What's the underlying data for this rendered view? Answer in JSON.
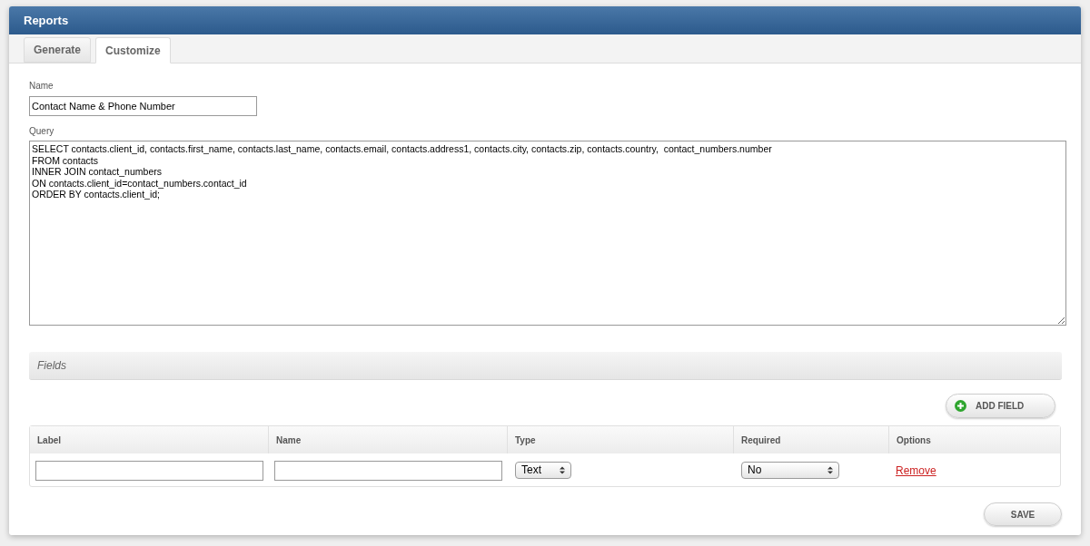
{
  "panel": {
    "title": "Reports"
  },
  "tabs": [
    {
      "label": "Generate",
      "selected": false
    },
    {
      "label": "Customize",
      "selected": true
    }
  ],
  "form": {
    "name_label": "Name",
    "name_value": "Contact Name & Phone Number",
    "query_label": "Query",
    "query_value": "SELECT contacts.client_id, contacts.first_name, contacts.last_name, contacts.email, contacts.address1, contacts.city, contacts.zip, contacts.country,  contact_numbers.number\nFROM contacts\nINNER JOIN contact_numbers\nON contacts.client_id=contact_numbers.contact_id\nORDER BY contacts.client_id;"
  },
  "fields_section": {
    "title": "Fields",
    "add_button": "ADD FIELD"
  },
  "table": {
    "columns": [
      "Label",
      "Name",
      "Type",
      "Required",
      "Options"
    ],
    "rows": [
      {
        "label": "",
        "name": "",
        "type": "Text",
        "required": "No",
        "action": "Remove"
      }
    ]
  },
  "save_button": "SAVE"
}
